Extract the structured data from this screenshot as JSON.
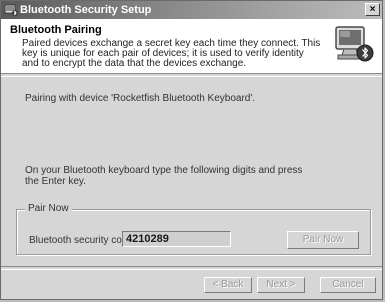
{
  "window": {
    "title": "Bluetooth Security Setup",
    "close_glyph": "×",
    "icon": "bluetooth-setup-icon"
  },
  "header": {
    "title": "Bluetooth Pairing",
    "description": "Paired devices exchange a secret key each time they connect. This key is unique for each pair of devices; it is used to verify identity and to encrypt the data that the devices exchange.",
    "icon": "computer-bluetooth-icon"
  },
  "body": {
    "pairing_message": "Pairing with device 'Rocketfish Bluetooth Keyboard'.",
    "instruction": "On your Bluetooth keyboard type the following digits and press the Enter key."
  },
  "pair_now_group": {
    "legend": "Pair Now",
    "code_label": "Bluetooth security code:",
    "code_value": "4210289",
    "pair_now_label": "Pair Now"
  },
  "footer": {
    "back_label": "< Back",
    "next_label": "Next >",
    "cancel_label": "Cancel"
  }
}
